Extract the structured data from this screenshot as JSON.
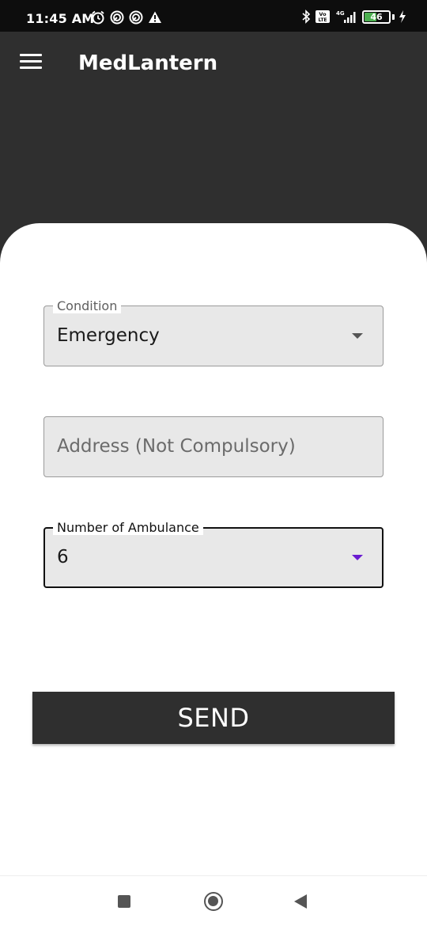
{
  "status_bar": {
    "time": "11:45 AM",
    "left_icons": [
      "alarm-icon",
      "data-saver-icon",
      "data-saver-icon",
      "warning-icon"
    ],
    "right_icons": [
      "bluetooth-icon",
      "volte-icon",
      "4g-signal-icon"
    ],
    "network": "4G",
    "volte": "Vo LTE",
    "battery_level": "46",
    "charging": true
  },
  "app_bar": {
    "title": "MedLantern",
    "menu_icon": "hamburger-menu-icon",
    "background": "#2f2f2f"
  },
  "form": {
    "condition": {
      "label": "Condition",
      "value": "Emergency"
    },
    "address": {
      "placeholder": "Address (Not Compulsory)",
      "value": ""
    },
    "ambulance": {
      "label": "Number of Ambulance",
      "value": "6"
    },
    "accent_color": "#6a1bd1"
  },
  "send_button": {
    "label": "SEND"
  },
  "nav_bar": {
    "buttons": [
      "recents-square-icon",
      "home-circle-icon",
      "back-triangle-icon"
    ]
  }
}
